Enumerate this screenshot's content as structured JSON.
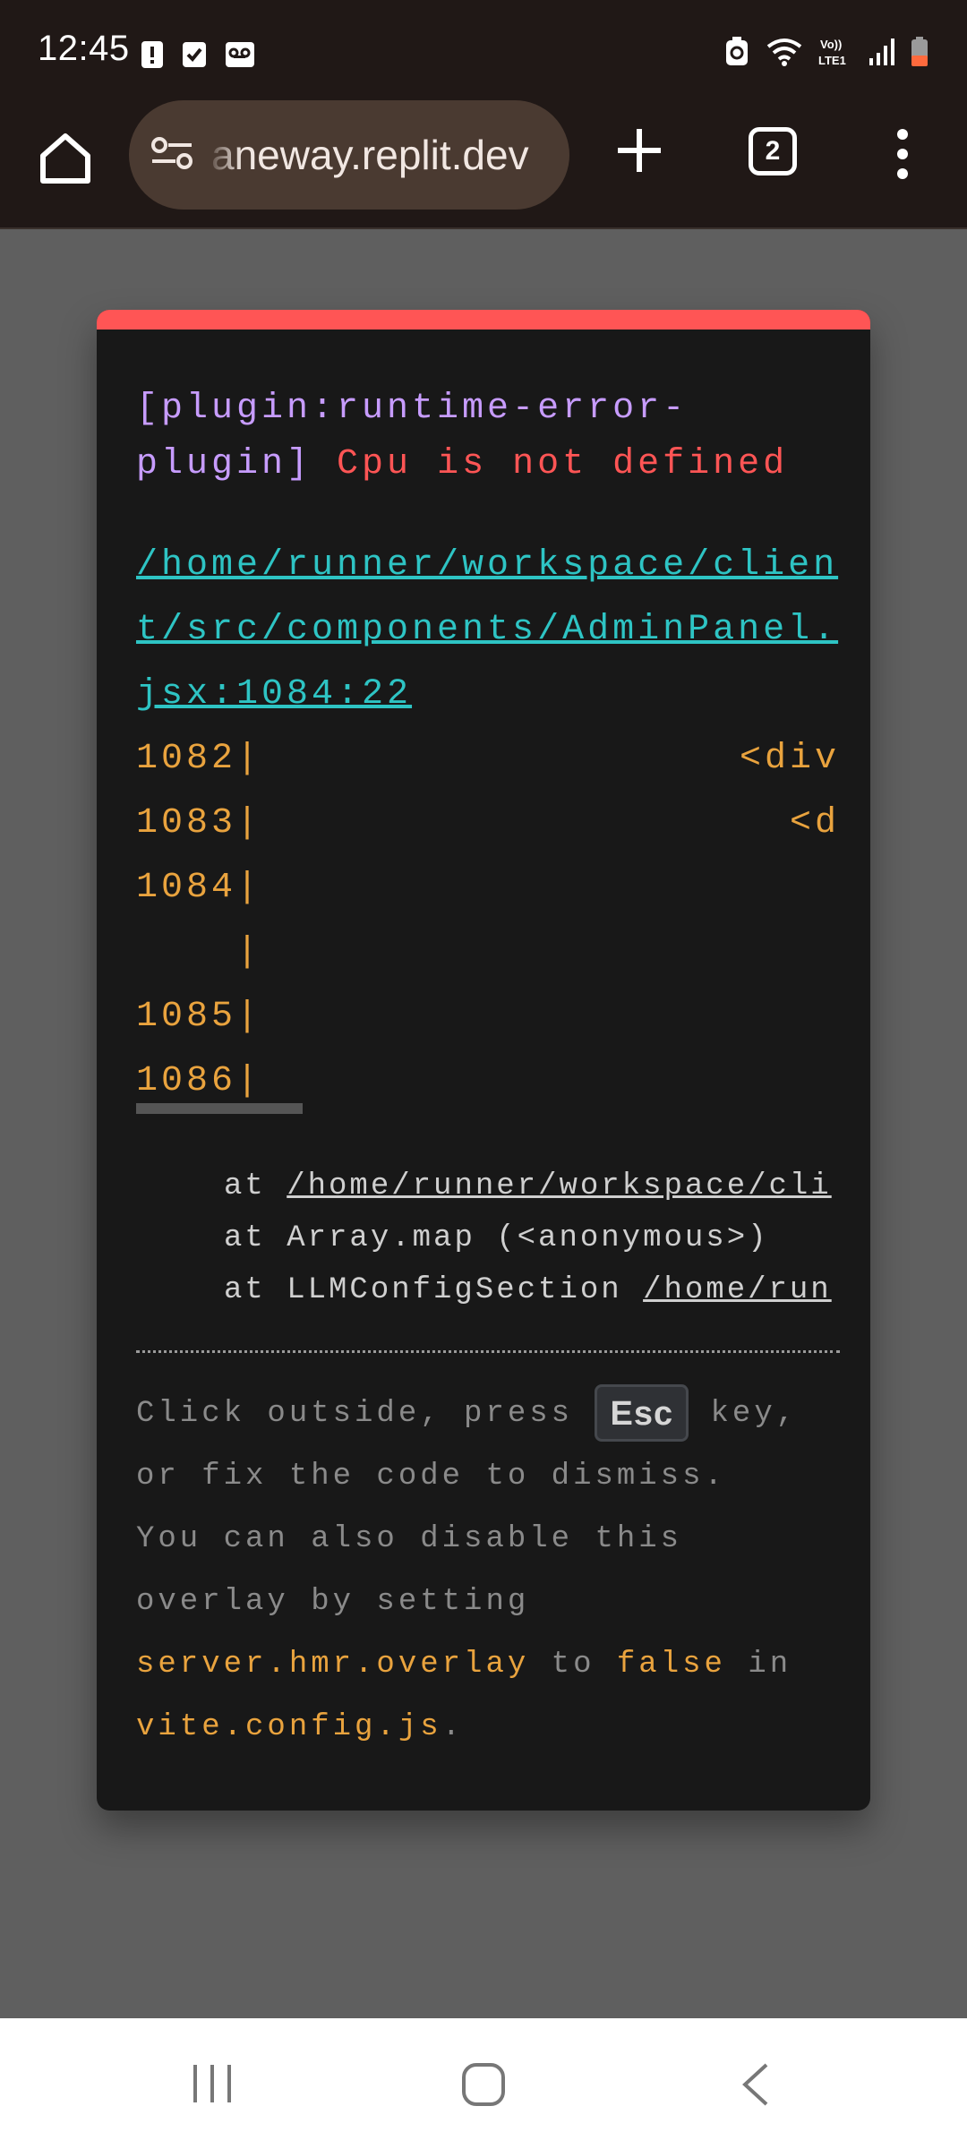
{
  "status_bar": {
    "time": "12:45",
    "left_icons": [
      "alert-icon",
      "check-box-icon",
      "voicemail-icon"
    ],
    "right_icons": [
      "battery-saver-icon",
      "wifi-icon",
      "volte-icon",
      "signal-icon",
      "battery-icon"
    ],
    "volte_label": "Vo))\nLTE1"
  },
  "browser": {
    "url": "aneway.replit.dev",
    "tab_count": "2"
  },
  "overlay": {
    "accent_color": "#ff5555",
    "plugin_label": "[plugin:runtime-error-plugin]",
    "message": "Cpu is not defined",
    "file_link": "/home/runner/workspace/client/src/components/AdminPanel.jsx:1084:22",
    "code_lines": [
      {
        "num": "1082|",
        "code": "<div"
      },
      {
        "num": "1083|",
        "code": "<d"
      },
      {
        "num": "1084|",
        "code": ""
      },
      {
        "num": "    |",
        "code": ""
      },
      {
        "num": "1085|",
        "code": ""
      },
      {
        "num": "1086|",
        "code": ""
      }
    ],
    "stack": [
      {
        "prefix": "at ",
        "text": "/home/runner/workspace/cli",
        "underline": true
      },
      {
        "prefix": "at ",
        "text": "Array.map (<anonymous>)",
        "underline": false
      },
      {
        "prefix": "at LLMConfigSection ",
        "text": "/home/run",
        "underline": true
      }
    ],
    "tip": {
      "part1": "Click outside, press ",
      "key": "Esc",
      "part2": " key, or fix the code to dismiss.",
      "part3": "You can also disable this overlay by setting",
      "code1": "server.hmr.overlay",
      "part4": " to ",
      "code2": "false",
      "part5": " in",
      "code3": "vite.config.js",
      "part6": "."
    }
  },
  "nav_bar": {
    "buttons": [
      "recents-icon",
      "home-icon",
      "back-icon"
    ]
  }
}
